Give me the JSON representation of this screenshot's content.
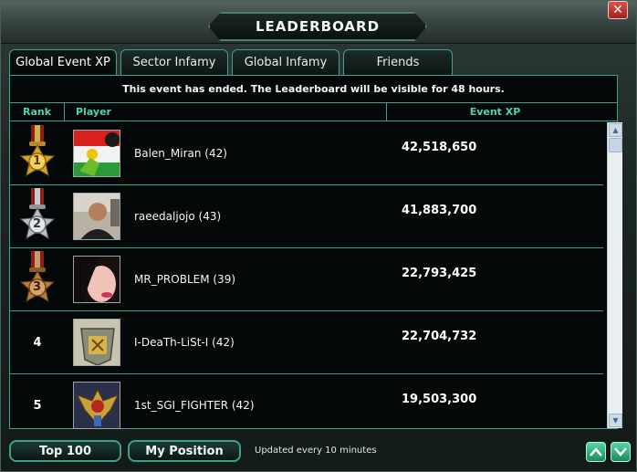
{
  "window": {
    "title": "LEADERBOARD",
    "close_label": "✕"
  },
  "tabs": [
    {
      "label": "Global Event XP",
      "active": true
    },
    {
      "label": "Sector Infamy",
      "active": false
    },
    {
      "label": "Global Infamy",
      "active": false
    },
    {
      "label": "Friends",
      "active": false
    }
  ],
  "notice": "This event has ended. The Leaderboard will be visible for 48 hours.",
  "columns": {
    "rank": "Rank",
    "player": "Player",
    "xp": "Event XP"
  },
  "rows": [
    {
      "rank": "1",
      "medal": "gold",
      "player": "Balen_Miran (42)",
      "xp": "42,518,650",
      "avatar_icon": "flag-avatar-icon"
    },
    {
      "rank": "2",
      "medal": "silver",
      "player": "raeedaljojo (43)",
      "xp": "41,883,700",
      "avatar_icon": "person-avatar-icon"
    },
    {
      "rank": "3",
      "medal": "bronze",
      "player": "MR_PROBLEM (39)",
      "xp": "22,793,425",
      "avatar_icon": "face-avatar-icon"
    },
    {
      "rank": "4",
      "medal": null,
      "player": "I-DeaTh-LiSt-I (42)",
      "xp": "22,704,732",
      "avatar_icon": "emblem-avatar-icon"
    },
    {
      "rank": "5",
      "medal": null,
      "player": "1st_SGI_FIGHTER (42)",
      "xp": "19,503,300",
      "avatar_icon": "crest-avatar-icon"
    }
  ],
  "buttons": {
    "top100": "Top 100",
    "my_position": "My Position"
  },
  "update_note": "Updated every 10 minutes",
  "colors": {
    "accent": "#3fa08c",
    "header_text": "#4fd3b0",
    "gold": "#d9a521",
    "silver": "#b9bec4",
    "bronze": "#b97a3e",
    "nav_green": "#38b57f"
  }
}
